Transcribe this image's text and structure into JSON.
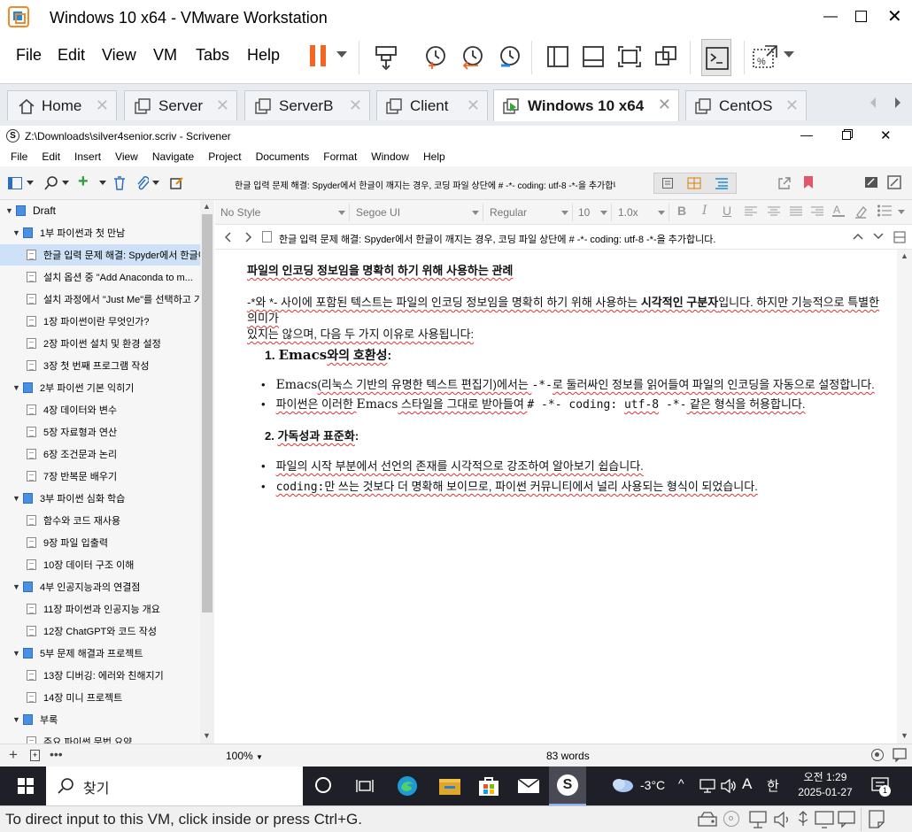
{
  "vm": {
    "title": "Windows 10 x64 - VMware Workstation",
    "menu": [
      "File",
      "Edit",
      "View",
      "VM",
      "Tabs",
      "Help"
    ],
    "tabs": [
      "Home",
      "Server",
      "ServerB",
      "Client",
      "Windows 10 x64",
      "CentOS"
    ],
    "status_message": "To direct input to this VM, click inside or press Ctrl+G."
  },
  "scrivener": {
    "window_title": "Z:\\Downloads\\silver4senior.scriv - Scrivener",
    "menu": [
      "File",
      "Edit",
      "Insert",
      "View",
      "Navigate",
      "Project",
      "Documents",
      "Format",
      "Window",
      "Help"
    ],
    "toolbar_title": "한글 입력 문제 해결: Spyder에서 한글이 깨지는 경우, 코딩 파일 상단에 # -*- coding: utf-8 -*-을 추가합니다.",
    "format": {
      "style": "No Style",
      "font": "Segoe UI",
      "weight": "Regular",
      "size": "10",
      "spacing": "1.0x"
    },
    "header_title": "한글 입력 문제 해결: Spyder에서 한글이 깨지는 경우, 코딩 파일 상단에 # -*- coding: utf-8 -*-을 추가합니다.",
    "binder": [
      {
        "label": "Draft",
        "type": "root"
      },
      {
        "label": "1부 파이썬과 첫 만남",
        "type": "folder"
      },
      {
        "label": "한글 입력 문제 해결: Spyder에서 한글이 ...",
        "type": "doc",
        "selected": true
      },
      {
        "label": "설치 옵션 중 \"Add Anaconda to m...",
        "type": "doc"
      },
      {
        "label": "설치 과정에서 \"Just Me\"를 선택하고 기...",
        "type": "doc"
      },
      {
        "label": "1장 파이썬이란 무엇인가?",
        "type": "doc"
      },
      {
        "label": "2장 파이썬 설치 및 환경 설정",
        "type": "doc"
      },
      {
        "label": "3장 첫 번째 프로그램 작성",
        "type": "doc"
      },
      {
        "label": "2부 파이썬 기본 익히기",
        "type": "folder"
      },
      {
        "label": "4장 데이터와 변수",
        "type": "doc"
      },
      {
        "label": "5장 자료형과 연산",
        "type": "doc"
      },
      {
        "label": "6장 조건문과 논리",
        "type": "doc"
      },
      {
        "label": "7장 반복문 배우기",
        "type": "doc"
      },
      {
        "label": "3부 파이썬 심화 학습",
        "type": "folder"
      },
      {
        "label": "함수와 코드 재사용",
        "type": "doc"
      },
      {
        "label": "9장 파일 입출력",
        "type": "doc"
      },
      {
        "label": "10장 데이터 구조 이해",
        "type": "doc"
      },
      {
        "label": "4부 인공지능과의 연결점",
        "type": "folder"
      },
      {
        "label": "11장 파이썬과 인공지능 개요",
        "type": "doc"
      },
      {
        "label": "12장 ChatGPT와 코드 작성",
        "type": "doc"
      },
      {
        "label": "5부 문제 해결과 프로젝트",
        "type": "folder"
      },
      {
        "label": "13장 디버깅: 에러와 친해지기",
        "type": "doc"
      },
      {
        "label": "14장 미니 프로젝트",
        "type": "doc"
      },
      {
        "label": "부록",
        "type": "folder"
      },
      {
        "label": "주요 파이썬 문법 요약",
        "type": "doc"
      }
    ],
    "doc": {
      "heading": "파일의 인코딩 정보임을 명확히 하기 위해 사용하는 관례",
      "para_a": "-*와 *- 사이에 포함된 텍스트는 파일의 인코딩 정보임을 명확히 하기 위해 사용하는 ",
      "para_bold": "시각적인 구분자",
      "para_b": "입니다. 하지만 기능적으로 특별한 의미가",
      "para_c": "있지는 않으며, 다음 두 가지 이유로 사용됩니다:",
      "item1_num": "1.",
      "item1_a": "Emacs",
      "item1_b": "와의 호환성",
      "item1_colon": ":",
      "b1_a": "Emacs",
      "b1_b": "(리눅스 기반의 유명한 텍스트 편집기)에서는 ",
      "b1_code": "-*-",
      "b1_c": "로 둘러싸인 정보를 읽어들여 파일의 인코딩을 자동으로 설정합니다.",
      "b2_a": "파이썬은 이러한 ",
      "b2_b": "Emacs",
      "b2_c": " 스타일을 그대로 받아들여 ",
      "b2_code1": "# -*- coding: ",
      "b2_code2": "utf-8",
      "b2_code3": " -*-",
      "b2_d": " 같은 형식을 허용합니다.",
      "item2_num": "2.",
      "item2_a": "가독성과 표준화",
      "item2_colon": ":",
      "b3": "파일의 시작 부분에서 선언의 존재를 시각적으로 강조하여 알아보기 쉽습니다.",
      "b4_code": "coding:",
      "b4_a": "만 쓰는 것보다 더 명확해 보이므로, 파이썬 커뮤니티에서 널리 사용되는 형식이 되었습니다."
    },
    "status": {
      "zoom": "100%",
      "words": "83 words"
    }
  },
  "taskbar": {
    "search_label": "찾기",
    "weather": "-3°C",
    "ime": "A",
    "ime2": "한",
    "time": "오전 1:29",
    "date": "2025-01-27",
    "notif_count": "1"
  },
  "colors": {
    "pause": "#f26522",
    "accent": "#4a90e2",
    "taskbar": "#1f1f27",
    "selection": "#cde1f7"
  }
}
